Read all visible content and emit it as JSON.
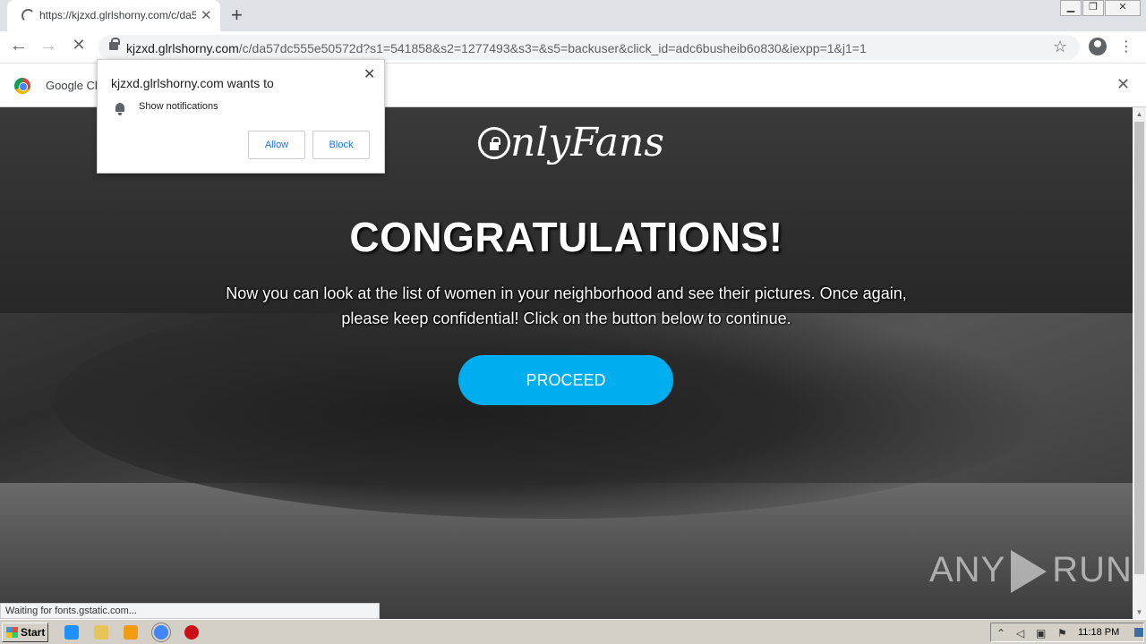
{
  "browser": {
    "tab_title": "https://kjzxd.glrlshorny.com/c/da57",
    "tab_close": "✕",
    "new_tab": "+",
    "url_host": "kjzxd.glrlshorny.com",
    "url_path": "/c/da57dc555e50572d?s1=541858&s2=1277493&s3=&s5=backuser&click_id=adc6busheib6o830&iexpp=1&j1=1",
    "back": "←",
    "forward": "→",
    "reload": "✕",
    "star": "☆",
    "menu": "⋮",
    "window_controls": {
      "minimize": "▁",
      "restore": "❐",
      "close": "✕"
    }
  },
  "infobar": {
    "text": "Google Ch",
    "close": "✕"
  },
  "popup": {
    "title": "kjzxd.glrlshorny.com wants to",
    "permission": "Show notifications",
    "allow": "Allow",
    "block": "Block",
    "close": "✕"
  },
  "page": {
    "logo_text": "nlyFans",
    "headline": "CONGRATULATIONS!",
    "subtext": "Now you can look at the list of women in your neighborhood and see their pictures. Once again, please keep confidential! Click on the button below to continue.",
    "proceed": "PROCEED",
    "watermark_left": "ANY",
    "watermark_right": "RUN"
  },
  "status": "Waiting for fonts.gstatic.com...",
  "taskbar": {
    "start": "Start",
    "clock": "11:18 PM",
    "icons": [
      "ie-icon",
      "folder-icon",
      "media-icon",
      "chrome-icon",
      "opera-icon"
    ],
    "colors": {
      "ie": "#1e90ff",
      "folder": "#e8c35a",
      "media": "#f39c12",
      "chrome": "#4285f4",
      "opera": "#cc0f16"
    }
  },
  "colors": {
    "proceed": "#00aeef",
    "tabstrip": "#dee1e6",
    "taskbar": "#d4d0c8"
  }
}
